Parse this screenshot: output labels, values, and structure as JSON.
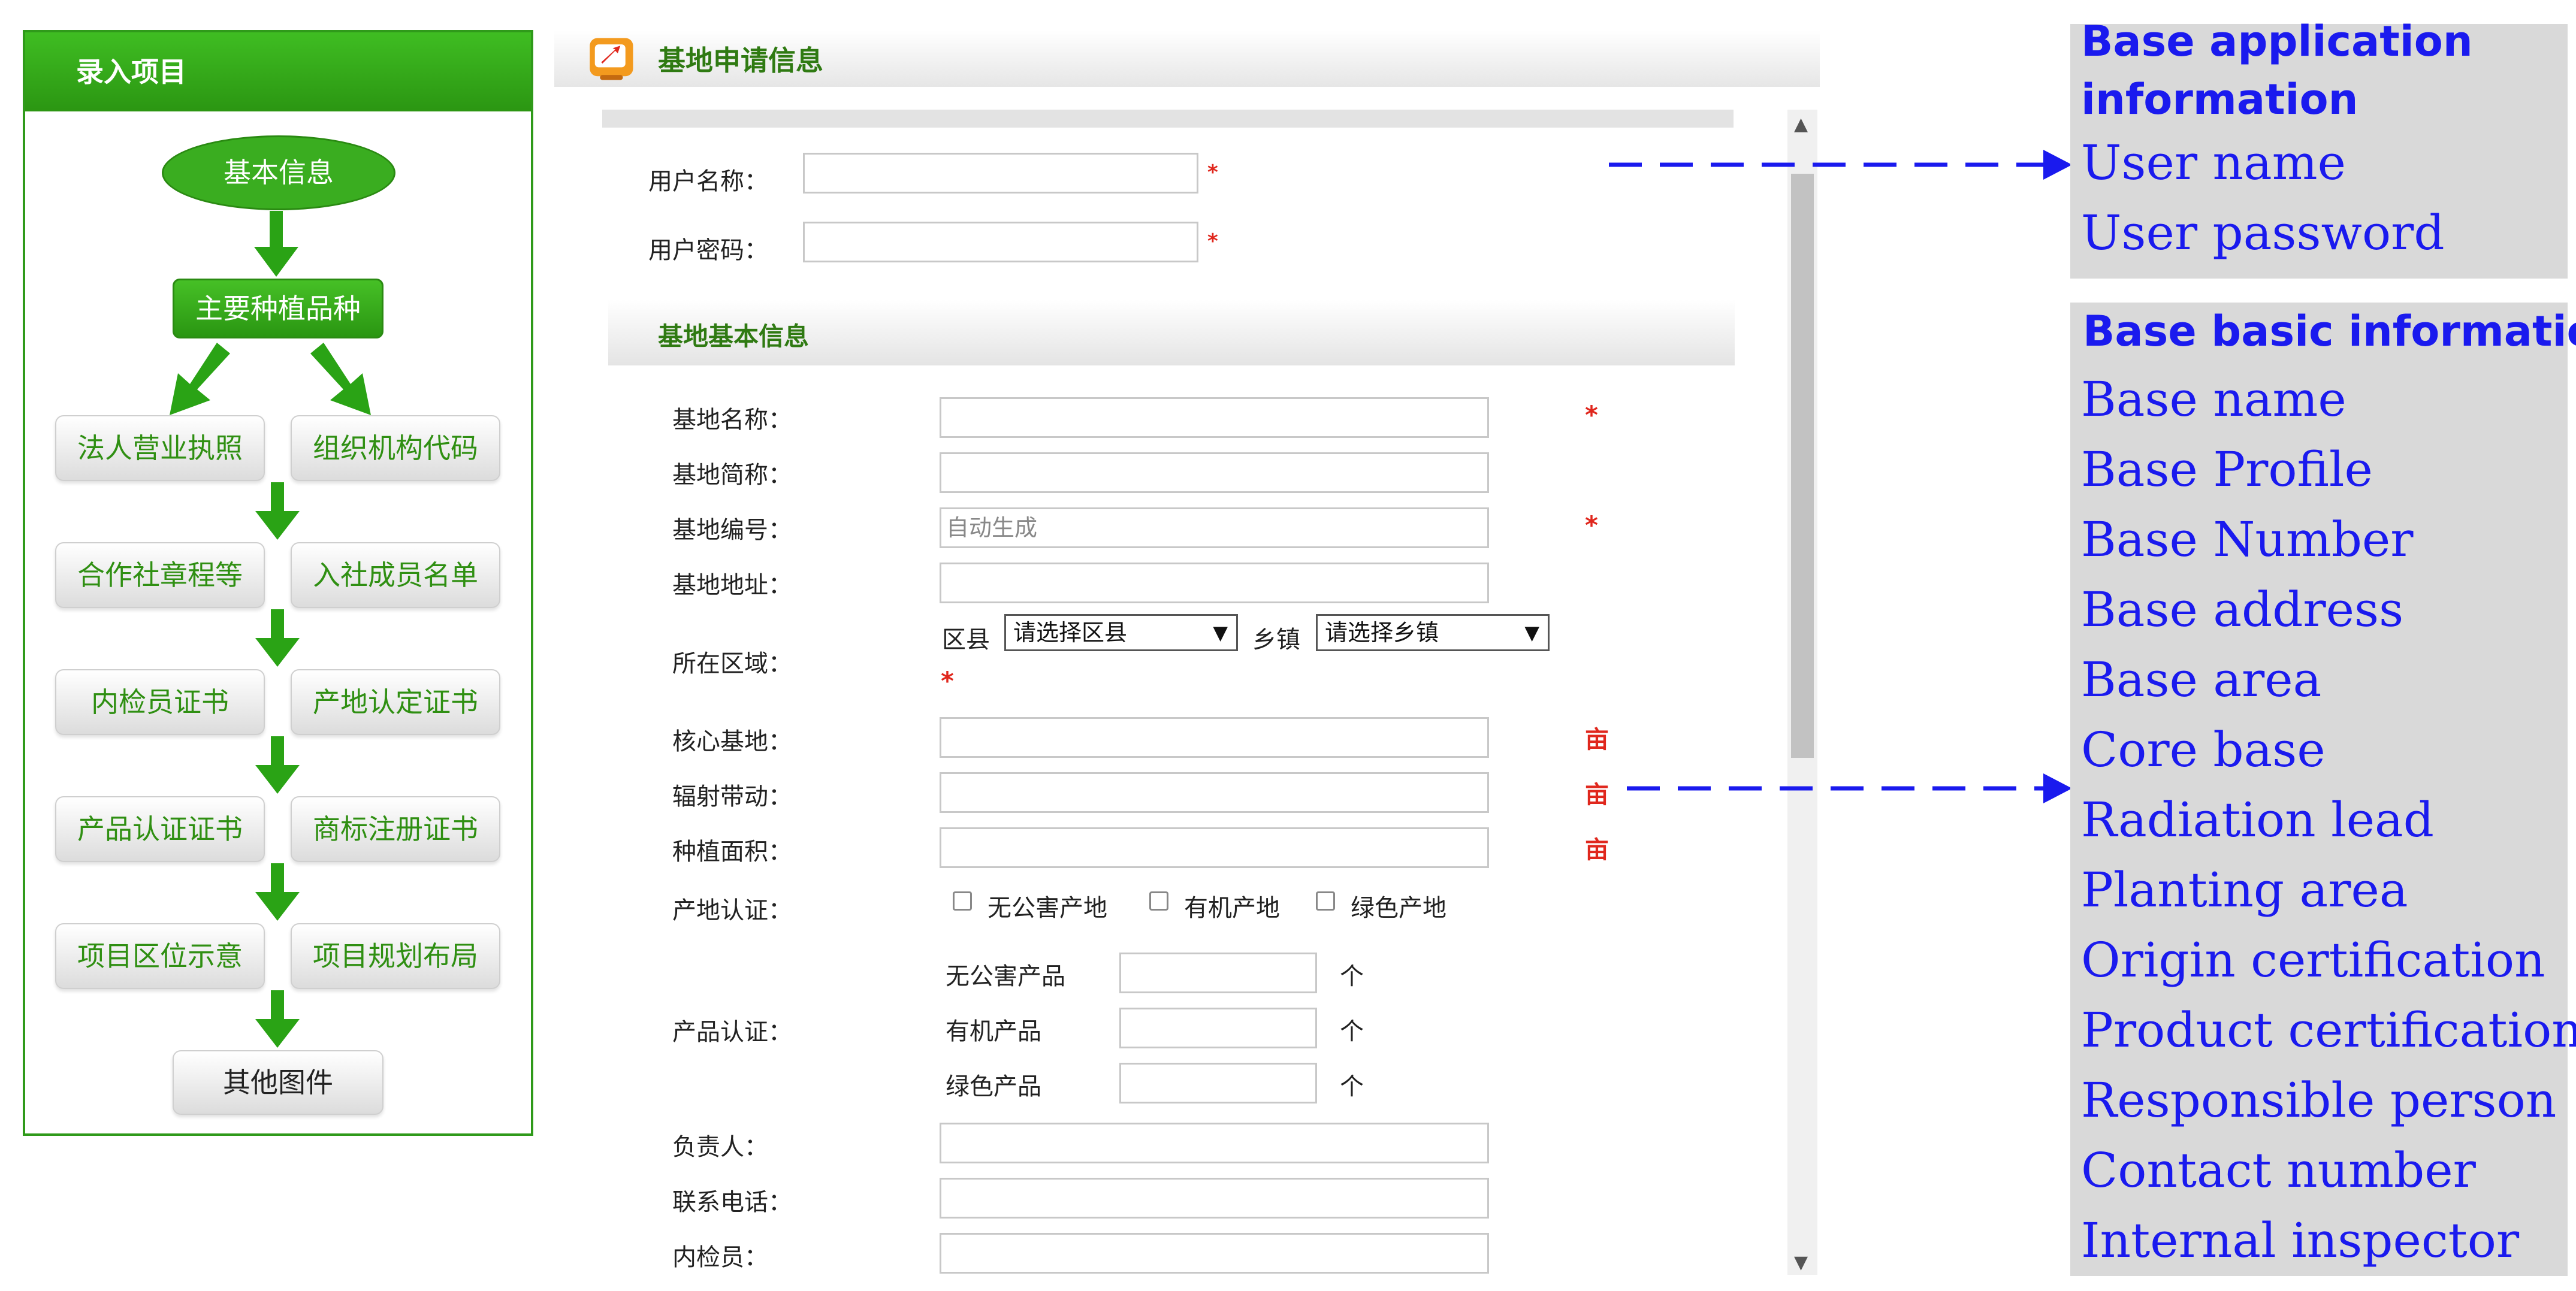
{
  "left": {
    "title": "录入项目",
    "nodes": {
      "basic_info": "基本信息",
      "main_varieties": "主要种植品种",
      "business_license": "法人营业执照",
      "org_code": "组织机构代码",
      "coop_charter": "合作社章程等",
      "member_list": "入社成员名单",
      "inspector_cert": "内检员证书",
      "origin_cert": "产地认定证书",
      "product_cert": "产品认证证书",
      "trademark_cert": "商标注册证书",
      "location_map": "项目区位示意",
      "planning_layout": "项目规划布局",
      "other_maps": "其他图件"
    }
  },
  "form": {
    "title": "基地申请信息",
    "username_label": "用户名称：",
    "password_label": "用户密码：",
    "section_title": "基地基本信息",
    "base_name_label": "基地名称：",
    "base_short_label": "基地简称：",
    "base_number_label": "基地编号：",
    "base_number_placeholder": "自动生成",
    "base_address_label": "基地地址：",
    "region_label": "所在区域：",
    "county_label": "区县",
    "county_select": "请选择区县",
    "town_label": "乡镇",
    "town_select": "请选择乡镇",
    "core_base_label": "核心基地：",
    "radiation_label": "辐射带动：",
    "planting_area_label": "种植面积：",
    "area_unit": "亩",
    "origin_cert_label": "产地认证：",
    "origin_options": [
      "无公害产地",
      "有机产地",
      "绿色产地"
    ],
    "product_cert_label": "产品认证：",
    "product_rows": [
      "无公害产品",
      "有机产品",
      "绿色产品"
    ],
    "count_unit": "个",
    "responsible_label": "负责人：",
    "phone_label": "联系电话：",
    "inspector_label": "内检员：",
    "required_mark": "*"
  },
  "legend": {
    "app_info_head_1": "Base application",
    "app_info_head_2": "information",
    "user_name": "User name",
    "user_password": "User password",
    "basic_info_head": "Base basic information",
    "items": [
      "Base name",
      "Base Profile",
      "Base Number",
      "Base address",
      "Base area",
      "Core base",
      "Radiation lead",
      "Planting area",
      "Origin certification",
      "Product certification",
      "Responsible person",
      "Contact number",
      "Internal inspector"
    ]
  },
  "colors": {
    "accent_green": "#2f9a1a",
    "required_red": "#e0271d",
    "legend_blue": "#1a1aee",
    "legend_bg": "#d9d9d9"
  }
}
